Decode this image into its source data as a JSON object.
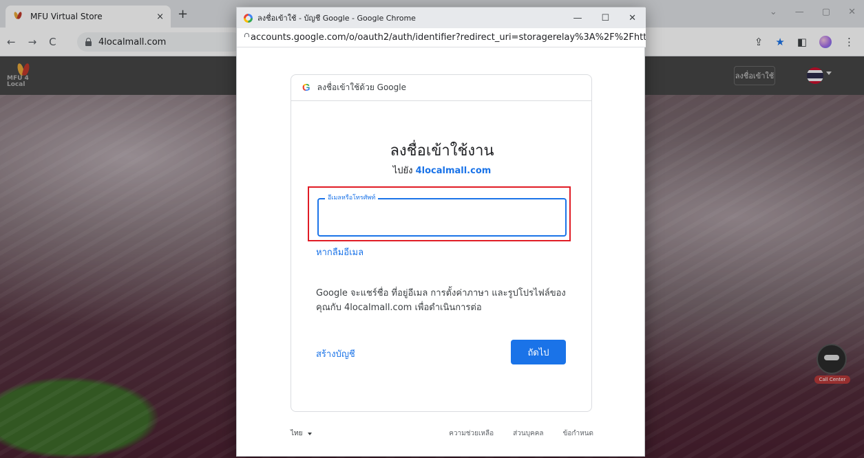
{
  "browser": {
    "tab_title": "MFU Virtual Store",
    "tab_close": "×",
    "new_tab": "+",
    "address": "4localmall.com",
    "nav_back": "←",
    "nav_forward": "→",
    "nav_reload": "C",
    "win_min": "⌄",
    "win_dash": "—",
    "win_max": "▢",
    "win_close": "✕"
  },
  "site": {
    "logo_text": "MFU 4 Local",
    "login_label": "ลงชื่อเข้าใช้",
    "avatar_badge": "Call Center"
  },
  "popup": {
    "window_title": "ลงชื่อเข้าใช้ - บัญชี Google - Google Chrome",
    "url": "accounts.google.com/o/oauth2/auth/identifier?redirect_uri=storagerelay%3A%2F%2Fhtt...",
    "win_min": "—",
    "win_max": "☐",
    "win_close": "✕"
  },
  "signin": {
    "header": "ลงชื่อเข้าใช้ด้วย Google",
    "title": "ลงชื่อเข้าใช้งาน",
    "subtitle_prefix": "ไปยัง",
    "subtitle_link": "4localmall.com",
    "field_label": "อีเมลหรือโทรศัพท์",
    "field_value": "",
    "forgot": "หากลืมอีเมล",
    "consent": "Google จะแชร์ชื่อ ที่อยู่อีเมล การตั้งค่าภาษา และรูปโปรไฟล์ของคุณกับ 4localmall.com เพื่อดำเนินการต่อ",
    "create_account": "สร้างบัญชี",
    "next": "ถัดไป"
  },
  "footer": {
    "language": "ไทย",
    "help": "ความช่วยเหลือ",
    "privacy": "ส่วนบุคคล",
    "terms": "ข้อกำหนด"
  },
  "colors": {
    "google_blue": "#1a73e8",
    "highlight_red": "#e01b24"
  }
}
